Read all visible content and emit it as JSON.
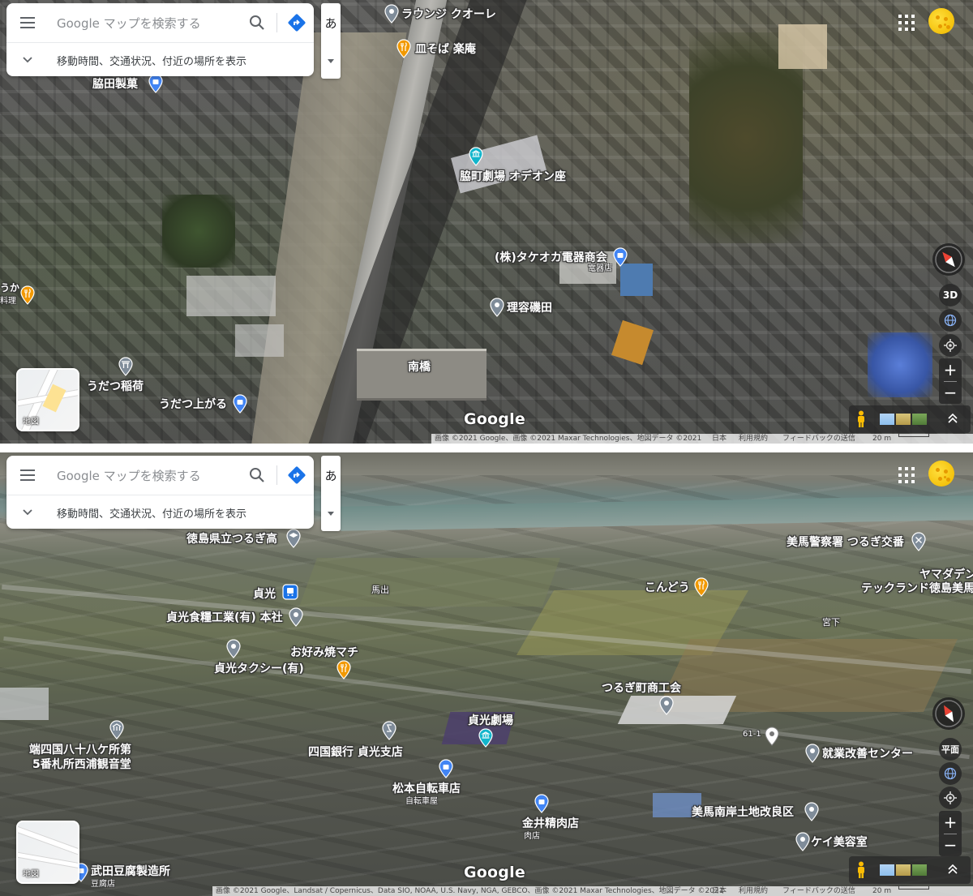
{
  "search": {
    "placeholder": "Google マップを検索する",
    "expand_label": "移動時間、交通状況、付近の場所を表示",
    "ime_char": "あ"
  },
  "icons": {
    "menu": "menu-icon",
    "search": "search-icon",
    "directions": "directions-icon",
    "expand": "chevron-down-icon",
    "ime_dropdown": "caret-down-icon",
    "apps": "apps-grid-icon",
    "compass": "compass-icon",
    "globe": "globe-icon",
    "location": "my-location-icon",
    "pegman": "pegman-icon",
    "expand_up": "chevron-up-icon"
  },
  "colors": {
    "directions_blue": "#1a73e8",
    "food_orange": "#f29900",
    "shop_blue": "#4285f4",
    "culture_teal": "#12b5cb",
    "generic_gray": "#7f8c99",
    "avatar_yellow": "#f4c20d",
    "compass_red": "#ea4335"
  },
  "panes": {
    "top": {
      "view_toggle": "3D",
      "minimap_label": "地図",
      "logo": "Google",
      "attribution": "画像 ©2021 Google、画像 ©2021 Maxar Technologies、地図データ ©2021",
      "footer_links": [
        "日本",
        "利用規約",
        "フィードバックの送信"
      ],
      "scale": "20 m",
      "partial_labels": [
        "うか",
        "料理"
      ],
      "place_labels": [
        {
          "text": "ラウンジ クオーレ",
          "icon": "generic"
        },
        {
          "text": "皿そば 楽庵",
          "icon": "food"
        },
        {
          "text": "脇田製菓",
          "icon": "shop"
        },
        {
          "text": "脇町劇場 オデオン座",
          "icon": "culture"
        },
        {
          "text": "(株)タケオカ電器商会",
          "sub": "電器店",
          "icon": "shop"
        },
        {
          "text": "理容磯田",
          "icon": "generic"
        },
        {
          "text": "うだつ稲荷",
          "icon": "shrine"
        },
        {
          "text": "うだつ上がる",
          "icon": "shop"
        },
        {
          "text": "南橋",
          "icon": "none"
        }
      ]
    },
    "bottom": {
      "view_toggle": "平面",
      "minimap_label": "地図",
      "logo": "Google",
      "attribution": "画像 ©2021 Google、Landsat / Copernicus、Data SIO, NOAA, U.S. Navy, NGA, GEBCO、画像 ©2021 Maxar Technologies、地図データ ©2021",
      "footer_links": [
        "日本",
        "利用規約",
        "フィードバックの送信"
      ],
      "scale": "20 m",
      "place_labels": [
        {
          "text": "徳島県立つるぎ高",
          "icon": "school"
        },
        {
          "text": "美馬警察署 つるぎ交番",
          "icon": "police"
        },
        {
          "text": "ヤマダデン",
          "icon": "none"
        },
        {
          "text": "テックランド徳島美馬",
          "icon": "none"
        },
        {
          "text": "貞光",
          "icon": "train"
        },
        {
          "text": "馬出",
          "icon": "none"
        },
        {
          "text": "こんどう",
          "icon": "food"
        },
        {
          "text": "貞光食糧工業(有) 本社",
          "icon": "generic"
        },
        {
          "text": "宮下",
          "icon": "none"
        },
        {
          "text": "お好み焼マチ",
          "icon": "food"
        },
        {
          "text": "貞光タクシー(有)",
          "icon": "generic"
        },
        {
          "text": "つるぎ町商工会",
          "icon": "generic"
        },
        {
          "text": "貞光劇場",
          "icon": "culture"
        },
        {
          "text": "61-1",
          "icon": "dropped"
        },
        {
          "text": "就業改善センター",
          "icon": "generic"
        },
        {
          "text": "端四国八十八ケ所第",
          "icon": "temple"
        },
        {
          "text": "5番札所西浦観音堂",
          "icon": "none"
        },
        {
          "text": "四国銀行 貞光支店",
          "icon": "bank"
        },
        {
          "text": "松本自転車店",
          "sub": "自転車屋",
          "icon": "shop"
        },
        {
          "text": "金井精肉店",
          "sub": "肉店",
          "icon": "shop"
        },
        {
          "text": "美馬南岸土地改良区",
          "icon": "generic"
        },
        {
          "text": "ケイ美容室",
          "icon": "generic"
        },
        {
          "text": "武田豆腐製造所",
          "sub": "豆腐店",
          "icon": "shop"
        }
      ]
    }
  }
}
